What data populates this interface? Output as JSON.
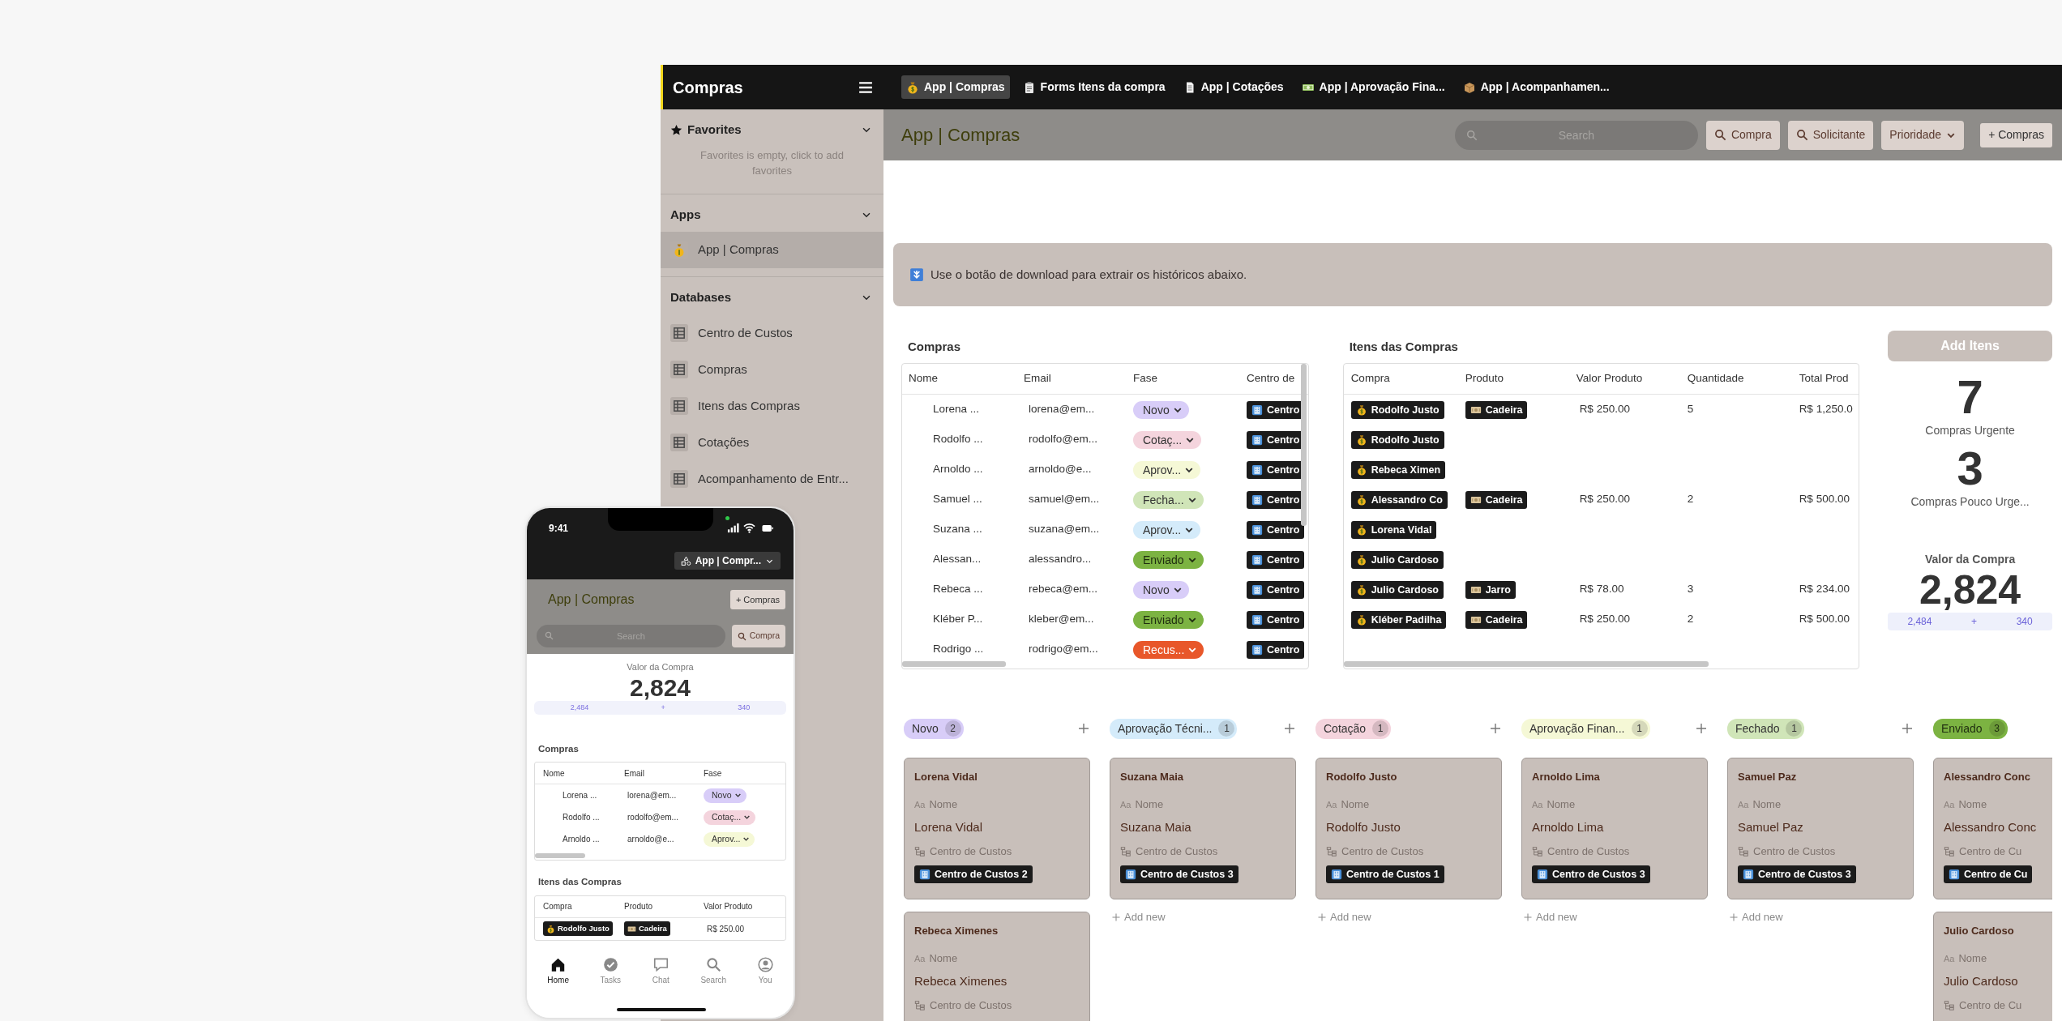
{
  "app_title": "Compras",
  "tabs": [
    {
      "label": "App | Compras",
      "selected": true
    },
    {
      "label": "Forms Itens da compra",
      "selected": false
    },
    {
      "label": "App | Cotações",
      "selected": false
    },
    {
      "label": "App | Aprovação Fina...",
      "selected": false
    },
    {
      "label": "App | Acompanhamen...",
      "selected": false
    }
  ],
  "sidebar": {
    "favorites": {
      "title": "Favorites",
      "empty_text": "Favorites is empty, click to add favorites"
    },
    "apps": {
      "title": "Apps",
      "items": [
        {
          "label": "App | Compras",
          "selected": true
        }
      ]
    },
    "databases": {
      "title": "Databases",
      "items": [
        {
          "label": "Centro de Custos",
          "selected": false
        },
        {
          "label": "Compras",
          "selected": false
        },
        {
          "label": "Itens das Compras",
          "selected": false
        },
        {
          "label": "Cotações",
          "selected": false
        },
        {
          "label": "Acompanhamento de Entr...",
          "selected": false
        }
      ]
    }
  },
  "header": {
    "title": "App | Compras",
    "search": {
      "placeholder": "Search"
    },
    "filters": [
      {
        "label": "Compra",
        "kind": "search"
      },
      {
        "label": "Solicitante",
        "kind": "search"
      },
      {
        "label": "Prioridade",
        "kind": "dropdown"
      }
    ],
    "add_button": "+ Compras"
  },
  "banner": "Use o botão de download para extrair os históricos abaixo.",
  "compras_table": {
    "title": "Compras",
    "columns": [
      "Nome",
      "Email",
      "Fase",
      "Centro de"
    ],
    "rows": [
      {
        "nome": "Lorena ...",
        "email": "lorena@em...",
        "fase": {
          "label": "Novo",
          "color": "#d8cdf8"
        },
        "centro": "Centro"
      },
      {
        "nome": "Rodolfo ...",
        "email": "rodolfo@em...",
        "fase": {
          "label": "Cotaç...",
          "color": "#f4d4dd"
        },
        "centro": "Centro"
      },
      {
        "nome": "Arnoldo ...",
        "email": "arnoldo@e...",
        "fase": {
          "label": "Aprov...",
          "color": "#f5f8d6"
        },
        "centro": "Centro"
      },
      {
        "nome": "Samuel ...",
        "email": "samuel@em...",
        "fase": {
          "label": "Fecha...",
          "color": "#d0e5b8"
        },
        "centro": "Centro"
      },
      {
        "nome": "Suzana ...",
        "email": "suzana@em...",
        "fase": {
          "label": "Aprov...",
          "color": "#d4ebfa"
        },
        "centro": "Centro"
      },
      {
        "nome": "Alessan...",
        "email": "alessandro...",
        "fase": {
          "label": "Enviado",
          "color": "#7cb342"
        },
        "centro": "Centro"
      },
      {
        "nome": "Rebeca ...",
        "email": "rebeca@em...",
        "fase": {
          "label": "Novo",
          "color": "#d8cdf8"
        },
        "centro": "Centro"
      },
      {
        "nome": "Kléber P...",
        "email": "kleber@em...",
        "fase": {
          "label": "Enviado",
          "color": "#7cb342"
        },
        "centro": "Centro"
      },
      {
        "nome": "Rodrigo ...",
        "email": "rodrigo@em...",
        "fase": {
          "label": "Recus...",
          "color": "#e8572a"
        },
        "centro": "Centro"
      }
    ]
  },
  "itens_table": {
    "title": "Itens das Compras",
    "columns": [
      "Compra",
      "Produto",
      "Valor Produto",
      "Quantidade",
      "Total Prod"
    ],
    "rows": [
      {
        "compra": "Rodolfo Justo",
        "produto": "Cadeira",
        "valor": "R$ 250.00",
        "quantidade": "5",
        "total": "R$ 1,250.0"
      },
      {
        "compra": "Rodolfo Justo"
      },
      {
        "compra": "Rebeca Ximen"
      },
      {
        "compra": "Alessandro Co",
        "produto": "Cadeira",
        "valor": "R$ 250.00",
        "quantidade": "2",
        "total": "R$ 500.00"
      },
      {
        "compra": "Lorena Vidal"
      },
      {
        "compra": "Julio Cardoso"
      },
      {
        "compra": "Julio Cardoso",
        "produto": "Jarro",
        "valor": "R$ 78.00",
        "quantidade": "3",
        "total": "R$ 234.00"
      },
      {
        "compra": "Kléber Padilha",
        "produto": "Cadeira",
        "valor": "R$ 250.00",
        "quantidade": "2",
        "total": "R$ 500.00"
      }
    ]
  },
  "stats": {
    "add_button": "Add Itens",
    "counters": [
      {
        "value": "7",
        "label": "Compras Urgente"
      },
      {
        "value": "3",
        "label": "Compras Pouco Urge..."
      }
    ],
    "valor": {
      "title": "Valor da Compra",
      "total": "2,824",
      "parts": [
        "2,484",
        "+",
        "340"
      ]
    }
  },
  "board": {
    "columns": [
      {
        "label": "Novo",
        "count": "2",
        "color": "#d8cdf8",
        "cards": [
          {
            "title": "Lorena Vidal",
            "field_glyph": "Aa",
            "name_label": "Nome",
            "name": "Lorena Vidal",
            "cc_label": "Centro de Custos",
            "cc": "Centro de Custos 2"
          },
          {
            "title": "Rebeca Ximenes",
            "field_glyph": "Aa",
            "name_label": "Nome",
            "name": "Rebeca Ximenes",
            "cc_label": "Centro de Custos"
          }
        ]
      },
      {
        "label": "Aprovação Técni...",
        "count": "1",
        "color": "#d4ebfa",
        "cards": [
          {
            "title": "Suzana Maia",
            "field_glyph": "Aa",
            "name_label": "Nome",
            "name": "Suzana Maia",
            "cc_label": "Centro de Custos",
            "cc": "Centro de Custos 3"
          }
        ],
        "add_new": "Add new"
      },
      {
        "label": "Cotação",
        "count": "1",
        "color": "#f4d4dd",
        "cards": [
          {
            "title": "Rodolfo Justo",
            "field_glyph": "Aa",
            "name_label": "Nome",
            "name": "Rodolfo Justo",
            "cc_label": "Centro de Custos",
            "cc": "Centro de Custos 1"
          }
        ],
        "add_new": "Add new"
      },
      {
        "label": "Aprovação Finan...",
        "count": "1",
        "color": "#f5f8d6",
        "cards": [
          {
            "title": "Arnoldo Lima",
            "field_glyph": "Aa",
            "name_label": "Nome",
            "name": "Arnoldo Lima",
            "cc_label": "Centro de Custos",
            "cc": "Centro de Custos 3"
          }
        ],
        "add_new": "Add new"
      },
      {
        "label": "Fechado",
        "count": "1",
        "color": "#d0e5b8",
        "cards": [
          {
            "title": "Samuel Paz",
            "field_glyph": "Aa",
            "name_label": "Nome",
            "name": "Samuel Paz",
            "cc_label": "Centro de Custos",
            "cc": "Centro de Custos 3"
          }
        ],
        "add_new": "Add new"
      },
      {
        "label": "Enviado",
        "count": "3",
        "color": "#7cb342",
        "cards": [
          {
            "title": "Alessandro Conc",
            "field_glyph": "Aa",
            "name_label": "Nome",
            "name": "Alessandro Conc",
            "cc_label": "Centro de Cu",
            "cc": "Centro de Cu"
          },
          {
            "title": "Julio Cardoso",
            "field_glyph": "Aa",
            "name_label": "Nome",
            "name": "Julio Cardoso",
            "cc_label": "Centro de Cu"
          }
        ]
      }
    ]
  },
  "phone": {
    "time": "9:41",
    "app_picker": "App | Compr...",
    "title": "App | Compras",
    "add_button": "+ Compras",
    "search": {
      "placeholder": "Search"
    },
    "search_button": "Compra",
    "valor": {
      "title": "Valor da Compra",
      "total": "2,824",
      "parts": [
        "2,484",
        "+",
        "340"
      ]
    },
    "compras": {
      "title": "Compras",
      "columns": [
        "Nome",
        "Email",
        "Fase"
      ],
      "rows": [
        {
          "nome": "Lorena ...",
          "email": "lorena@em...",
          "fase": {
            "label": "Novo",
            "color": "#d8cdf8"
          }
        },
        {
          "nome": "Rodolfo ...",
          "email": "rodolfo@em...",
          "fase": {
            "label": "Cotaç...",
            "color": "#f4d4dd"
          }
        },
        {
          "nome": "Arnoldo ...",
          "email": "arnoldo@e...",
          "fase": {
            "label": "Aprov...",
            "color": "#f5f8d6"
          }
        }
      ]
    },
    "itens": {
      "title": "Itens das Compras",
      "columns": [
        "Compra",
        "Produto",
        "Valor Produto"
      ],
      "rows": [
        {
          "compra": "Rodolfo Justo",
          "produto": "Cadeira",
          "valor": "R$ 250.00"
        }
      ]
    },
    "nav": [
      {
        "label": "Home",
        "selected": true
      },
      {
        "label": "Tasks",
        "selected": false
      },
      {
        "label": "Chat",
        "selected": false
      },
      {
        "label": "Search",
        "selected": false
      },
      {
        "label": "You",
        "selected": false
      }
    ]
  }
}
